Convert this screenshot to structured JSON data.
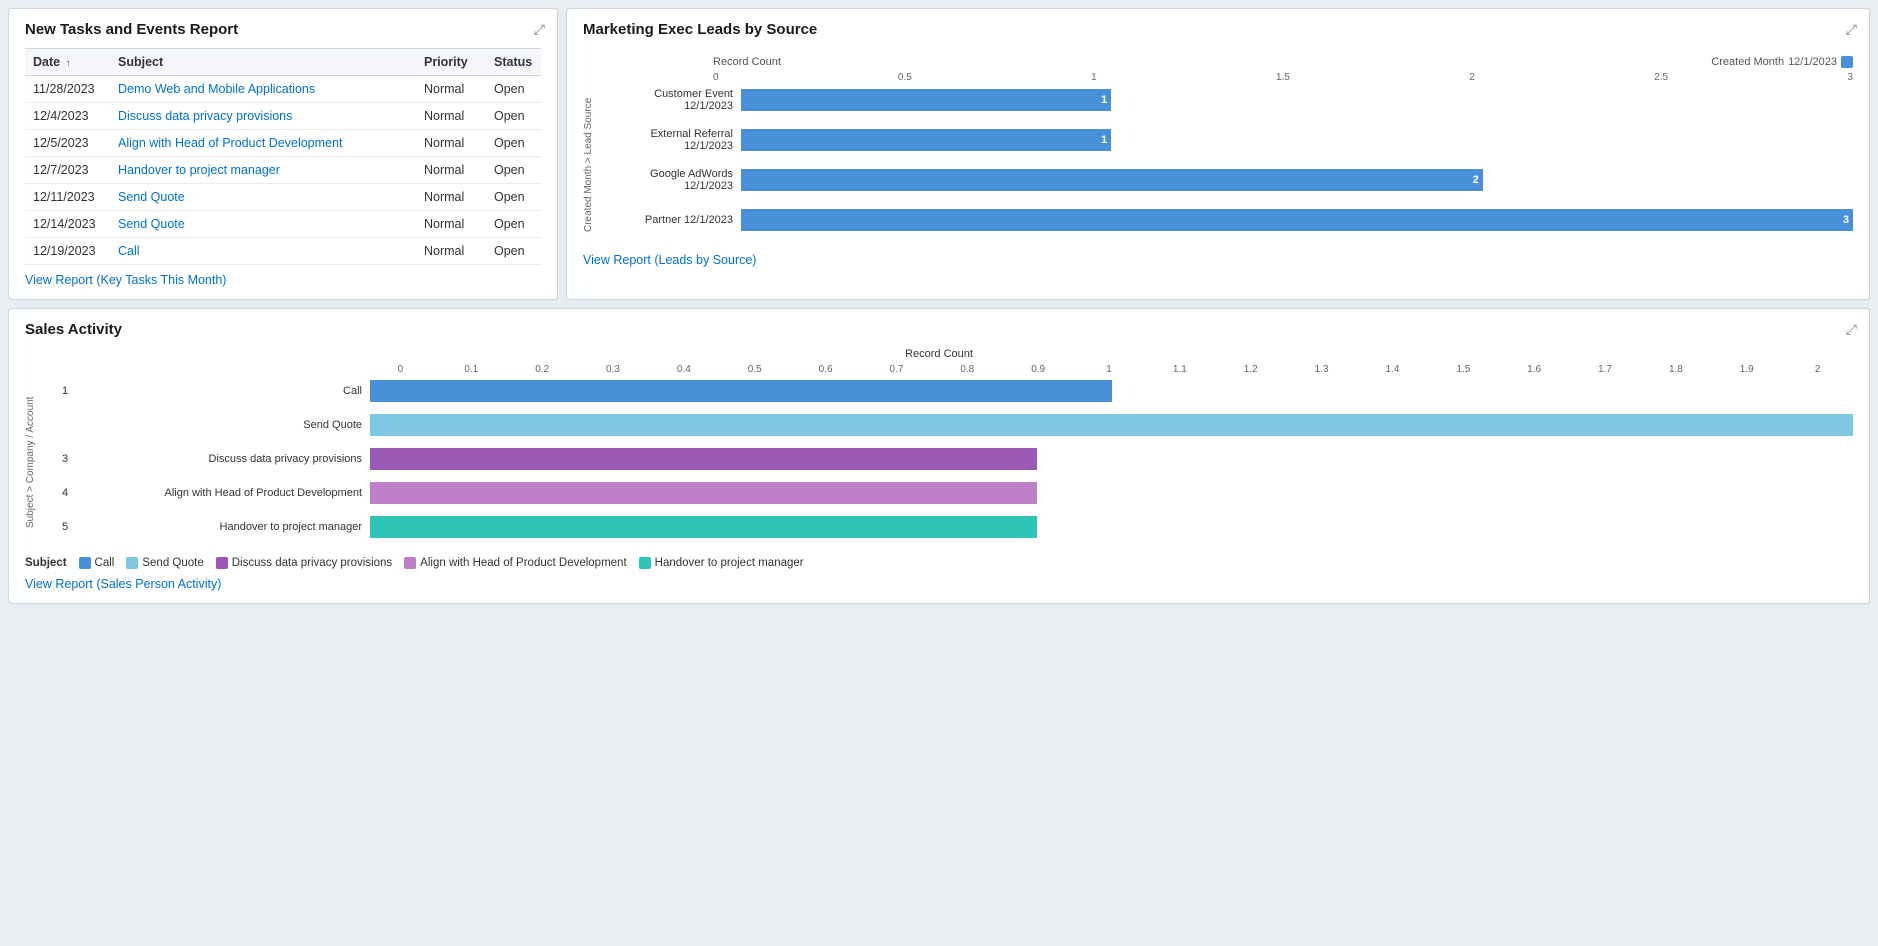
{
  "tasksPanel": {
    "title": "New Tasks and Events Report",
    "columns": [
      "Date",
      "Subject",
      "Priority",
      "Status"
    ],
    "rows": [
      {
        "date": "11/28/2023",
        "subject": "Demo Web and Mobile Applications",
        "priority": "Normal",
        "status": "Open"
      },
      {
        "date": "12/4/2023",
        "subject": "Discuss data privacy provisions",
        "priority": "Normal",
        "status": "Open"
      },
      {
        "date": "12/5/2023",
        "subject": "Align with Head of Product Development",
        "priority": "Normal",
        "status": "Open"
      },
      {
        "date": "12/7/2023",
        "subject": "Handover to project manager",
        "priority": "Normal",
        "status": "Open"
      },
      {
        "date": "12/11/2023",
        "subject": "Send Quote",
        "priority": "Normal",
        "status": "Open"
      },
      {
        "date": "12/14/2023",
        "subject": "Send Quote",
        "priority": "Normal",
        "status": "Open"
      },
      {
        "date": "12/19/2023",
        "subject": "Call",
        "priority": "Normal",
        "status": "Open"
      }
    ],
    "viewReport": "View Report (Key Tasks This Month)"
  },
  "marketingPanel": {
    "title": "Marketing Exec Leads by Source",
    "recordCountLabel": "Record Count",
    "createdMonthLabel": "Created Month",
    "legendDate": "12/1/2023",
    "legendColor": "#4a90d9",
    "xTicks": [
      "0",
      "0.5",
      "1",
      "1.5",
      "2",
      "2.5",
      "3"
    ],
    "yAxisLabel": "Created Month > Lead Source",
    "bars": [
      {
        "label": "Customer Event  12/1/2023",
        "value": 1,
        "pct": 33.3
      },
      {
        "label": "External Referral  12/1/2023",
        "value": 1,
        "pct": 33.3
      },
      {
        "label": "Google AdWords  12/1/2023",
        "value": 2,
        "pct": 66.7
      },
      {
        "label": "Partner  12/1/2023",
        "value": 3,
        "pct": 100
      }
    ],
    "viewReport": "View Report (Leads by Source)"
  },
  "salesPanel": {
    "title": "Sales Activity",
    "recordCountLabel": "Record Count",
    "yAxisLabel": "Subject > Company / Account",
    "xTicks": [
      "0",
      "0.1",
      "0.2",
      "0.3",
      "0.4",
      "0.5",
      "0.6",
      "0.7",
      "0.8",
      "0.9",
      "1",
      "1.1",
      "1.2",
      "1.3",
      "1.4",
      "1.5",
      "1.6",
      "1.7",
      "1.8",
      "1.9",
      "2"
    ],
    "bars": [
      {
        "num": "1",
        "label": "Call",
        "value": 1,
        "pct": 50,
        "color": "#4a90d9"
      },
      {
        "num": "",
        "label": "Send Quote",
        "value": 2,
        "pct": 100,
        "color": "#7ec8e3"
      },
      {
        "num": "3",
        "label": "Discuss data privacy provisions",
        "value": 0.9,
        "pct": 45,
        "color": "#9b59b6"
      },
      {
        "num": "4",
        "label": "Align with Head of Product Development",
        "value": 0.9,
        "pct": 45,
        "color": "#bf7ec8"
      },
      {
        "num": "5",
        "label": "Handover to project manager",
        "value": 0.9,
        "pct": 45,
        "color": "#2ec4b6"
      }
    ],
    "legend": [
      {
        "label": "Call",
        "color": "#4a90d9"
      },
      {
        "label": "Send Quote",
        "color": "#7ec8e3"
      },
      {
        "label": "Discuss data privacy provisions",
        "color": "#9b59b6"
      },
      {
        "label": "Align with Head of Product Development",
        "color": "#bf7ec8"
      },
      {
        "label": "Handover to project manager",
        "color": "#2ec4b6"
      }
    ],
    "subjectLabel": "Subject",
    "viewReport": "View Report (Sales Person Activity)"
  }
}
